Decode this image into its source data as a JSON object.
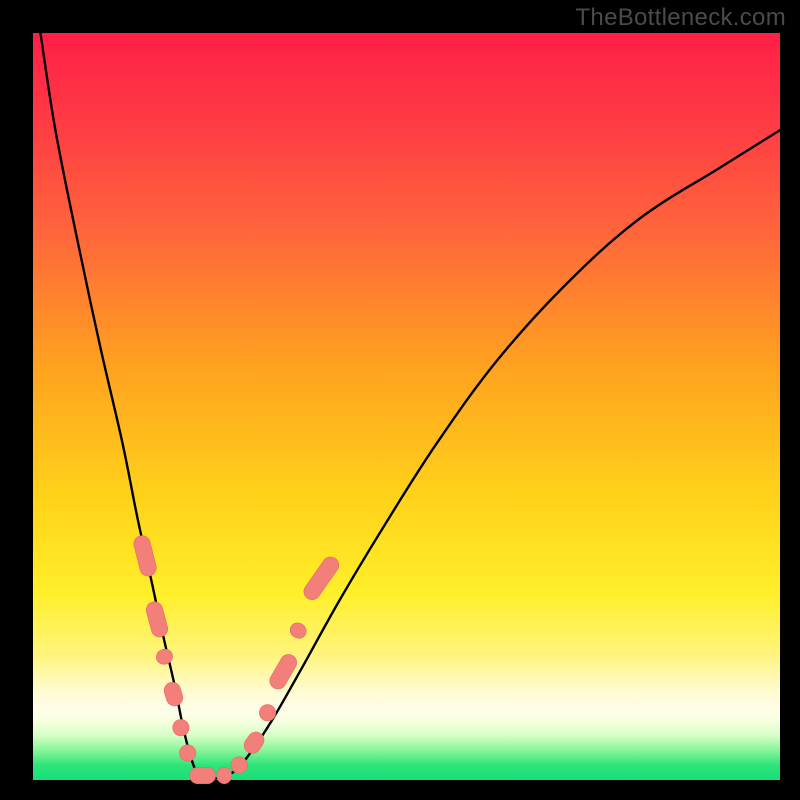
{
  "watermark": "TheBottleneck.com",
  "colors": {
    "frame": "#000000",
    "curve": "#000000",
    "marker_fill": "#f37f7a",
    "marker_stroke": "#e66a63"
  },
  "chart_data": {
    "type": "line",
    "title": "",
    "xlabel": "",
    "ylabel": "",
    "xlim": [
      0,
      100
    ],
    "ylim": [
      0,
      100
    ],
    "grid": false,
    "note": "Values read from pixel positions relative to 747x747 plot area; x,y as percent of axis range (0=left/bottom, 100=right/top). Curve is a V-shaped bottleneck curve.",
    "series": [
      {
        "name": "bottleneck-curve",
        "x": [
          1,
          3,
          6,
          9,
          12,
          14,
          16,
          17.5,
          19,
          20,
          21,
          22,
          23.5,
          25,
          27,
          29,
          32,
          36,
          41,
          47,
          54,
          62,
          71,
          81,
          92,
          100
        ],
        "y": [
          100,
          87,
          72,
          58,
          45,
          35,
          26,
          19,
          12.5,
          7.5,
          3.5,
          1,
          0.3,
          0.3,
          1.2,
          3.5,
          8,
          15,
          24,
          34,
          45,
          56,
          66,
          75,
          82,
          87
        ]
      }
    ],
    "markers": {
      "name": "highlight-pills",
      "note": "Pink pill-shaped markers along the lower part of the curve. Each entry: center x%, center y%, angle deg (0=horizontal), length%, thickness%.",
      "items": [
        {
          "x": 15.0,
          "y": 30.0,
          "angle": 76,
          "len": 5.5,
          "th": 2.2
        },
        {
          "x": 16.6,
          "y": 21.5,
          "angle": 75,
          "len": 4.8,
          "th": 2.2
        },
        {
          "x": 17.6,
          "y": 16.5,
          "angle": 74,
          "len": 2.0,
          "th": 2.2
        },
        {
          "x": 18.8,
          "y": 11.5,
          "angle": 73,
          "len": 3.2,
          "th": 2.2
        },
        {
          "x": 19.8,
          "y": 7.0,
          "angle": 72,
          "len": 2.2,
          "th": 2.2
        },
        {
          "x": 20.7,
          "y": 3.6,
          "angle": 68,
          "len": 2.2,
          "th": 2.2
        },
        {
          "x": 22.7,
          "y": 0.6,
          "angle": 0,
          "len": 3.5,
          "th": 2.2
        },
        {
          "x": 25.6,
          "y": 0.6,
          "angle": 0,
          "len": 2.0,
          "th": 2.2
        },
        {
          "x": 27.6,
          "y": 2.0,
          "angle": -50,
          "len": 2.2,
          "th": 2.2
        },
        {
          "x": 29.6,
          "y": 5.0,
          "angle": -55,
          "len": 3.0,
          "th": 2.2
        },
        {
          "x": 31.4,
          "y": 9.0,
          "angle": -60,
          "len": 2.2,
          "th": 2.2
        },
        {
          "x": 33.5,
          "y": 14.5,
          "angle": -60,
          "len": 5.0,
          "th": 2.2
        },
        {
          "x": 35.5,
          "y": 20.0,
          "angle": -58,
          "len": 2.0,
          "th": 2.2
        },
        {
          "x": 38.6,
          "y": 27.0,
          "angle": -55,
          "len": 6.5,
          "th": 2.2
        }
      ]
    }
  }
}
